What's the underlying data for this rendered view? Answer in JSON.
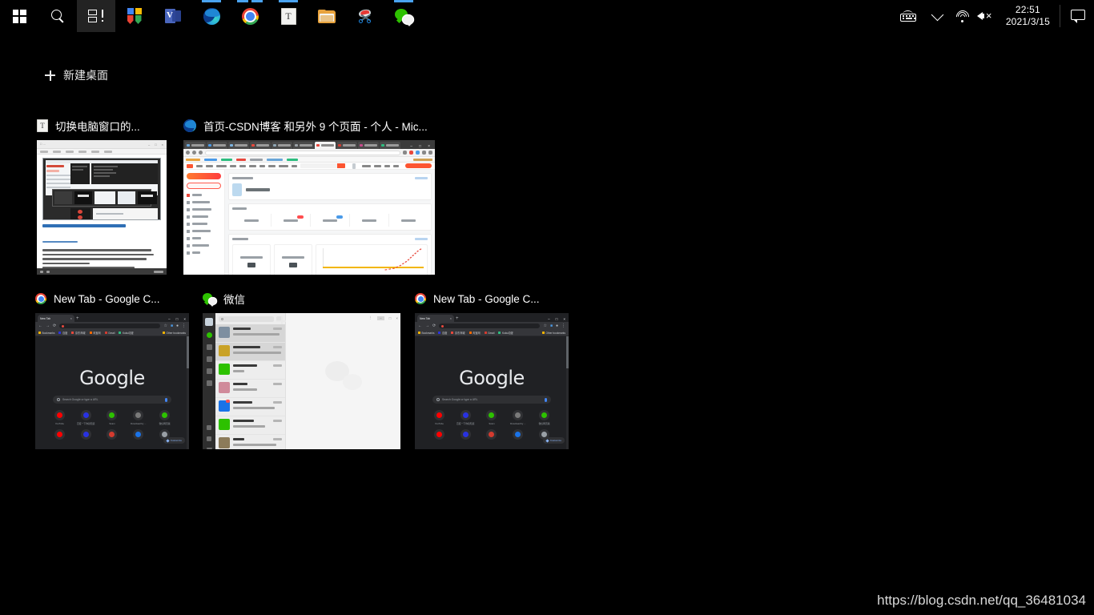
{
  "taskbar": {
    "start_label": "Start",
    "search_label": "Search",
    "taskview_label": "Task View",
    "pinned": [
      {
        "name": "office-icon",
        "label": "Office",
        "indicator": "none"
      },
      {
        "name": "visio-icon",
        "label": "Visio",
        "indicator": "none"
      },
      {
        "name": "edge-icon",
        "label": "Microsoft Edge",
        "indicator": "single"
      },
      {
        "name": "chrome-icon",
        "label": "Google Chrome",
        "indicator": "dual"
      },
      {
        "name": "typora-icon",
        "label": "Typora",
        "indicator": "single"
      },
      {
        "name": "file-explorer-icon",
        "label": "File Explorer",
        "indicator": "none"
      },
      {
        "name": "snipping-tool-icon",
        "label": "Snipping Tool",
        "indicator": "none"
      },
      {
        "name": "wechat-icon",
        "label": "WeChat",
        "indicator": "single"
      }
    ],
    "tray": {
      "keyboard_label": "Touch keyboard",
      "chevron_label": "Show hidden icons",
      "network_label": "Network",
      "volume_label": "Volume muted",
      "time": "22:51",
      "date": "2021/3/15",
      "notifications_label": "Notifications"
    }
  },
  "taskview": {
    "new_desktop_label": "新建桌面",
    "plus_icon": "plus-icon",
    "cards": [
      {
        "id": "typora",
        "title": "切换电脑窗口的...",
        "icon": "typora-icon",
        "app": "typora"
      },
      {
        "id": "edge",
        "title": "首页-CSDN博客 和另外 9 个页面 - 个人 - Mic...",
        "icon": "edge-icon",
        "app": "edge"
      },
      {
        "id": "chrome-1",
        "title": "New Tab - Google C...",
        "icon": "chrome-icon",
        "app": "chrome"
      },
      {
        "id": "wechat",
        "title": "微信",
        "icon": "wechat-icon",
        "app": "wechat"
      },
      {
        "id": "chrome-2",
        "title": "New Tab - Google C...",
        "icon": "chrome-icon",
        "app": "chrome"
      }
    ]
  },
  "chrome_thumb": {
    "tab_title": "New Tab",
    "google_wordmark": "Google",
    "search_placeholder": "Search Google or type a URL",
    "bookmarks": [
      "Bookmarks",
      "百度",
      "京东商城",
      "淘宝网",
      "Gmail",
      "Kuku动漫"
    ],
    "other_bookmarks": "Other bookmarks",
    "customize_label": "Customize",
    "tiles": [
      {
        "label": "YouTube",
        "color": "#ff0000"
      },
      {
        "label": "百度一下你就知道",
        "color": "#2932e1"
      },
      {
        "label": "Scam",
        "color": "#2dc100"
      },
      {
        "label": "Download by ...",
        "color": "#7a7a7a"
      },
      {
        "label": "微信网页版",
        "color": "#2dc100"
      }
    ],
    "tiles_row2": [
      {
        "label": "",
        "color": "#ff0000"
      },
      {
        "label": "",
        "color": "#2932e1"
      },
      {
        "label": "",
        "color": "#d43b2f"
      },
      {
        "label": "",
        "color": "#1a73e8"
      },
      {
        "label": "",
        "color": "#9aa0a6"
      }
    ]
  },
  "wechat_thumb": {
    "search_placeholder": "搜索",
    "chats": [
      {
        "avatar": "#7e8fa0",
        "unread": false
      },
      {
        "avatar": "#c9a227",
        "unread": false
      },
      {
        "avatar": "#2dc100",
        "unread": false
      },
      {
        "avatar": "#d08a9a",
        "unread": false
      },
      {
        "avatar": "#1a73e8",
        "unread": true
      },
      {
        "avatar": "#2dc100",
        "unread": false
      },
      {
        "avatar": "#8c7b5a",
        "unread": false
      },
      {
        "avatar": "#4a6fa5",
        "unread": false
      }
    ]
  },
  "csdn_thumb": {
    "sidebar_button_primary": "VIP",
    "sidebar_button_secondary": "创作中心",
    "sidebar_items_count": 9,
    "tabs_count": 5,
    "stats_count": 2,
    "chart": {
      "legend_colors": [
        "#e8483c",
        "#4a9ae8",
        "#2dbd7f",
        "#f2b600"
      ],
      "flat_line_color": "#f2b600",
      "rising_line_color": "#e8483c"
    }
  },
  "watermark": {
    "url": "https://blog.csdn.net/qq_36481034"
  },
  "colors": {
    "taskbar_bg": "#000000",
    "desktop_bg": "#000000",
    "indicator": "#4aa3f0",
    "text": "#ffffff"
  }
}
